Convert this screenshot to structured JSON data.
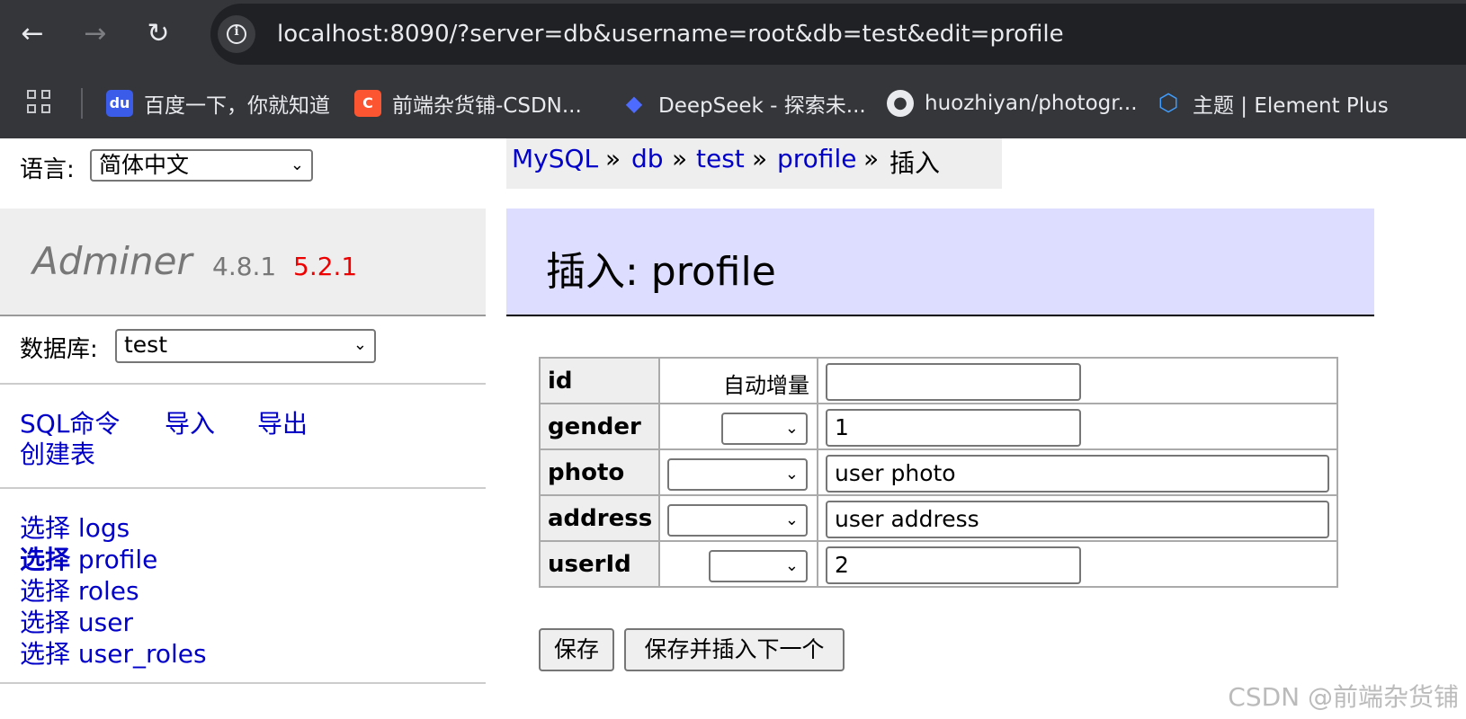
{
  "browser": {
    "back": "←",
    "forward": "→",
    "reload": "↻",
    "url": "localhost:8090/?server=db&username=root&db=test&edit=profile",
    "bookmarks": [
      {
        "label": "百度一下，你就知道",
        "icon": "baidu-icon"
      },
      {
        "label": "前端杂货铺-CSDN...",
        "icon": "csdn-icon"
      },
      {
        "label": "DeepSeek - 探索未...",
        "icon": "deepseek-icon"
      },
      {
        "label": "huozhiyan/photogr...",
        "icon": "github-icon"
      },
      {
        "label": "主题 | Element Plus",
        "icon": "element-plus-icon"
      }
    ]
  },
  "sidebar": {
    "lang_label": "语言:",
    "lang_value": "简体中文",
    "brand": "Adminer",
    "version": "4.8.1",
    "new_version": "5.2.1",
    "db_label": "数据库:",
    "db_value": "test",
    "links": [
      "SQL命令",
      "导入",
      "导出",
      "创建表"
    ],
    "tables": [
      {
        "action": "选择",
        "name": "logs"
      },
      {
        "action": "选择",
        "name": "profile"
      },
      {
        "action": "选择",
        "name": "roles"
      },
      {
        "action": "选择",
        "name": "user"
      },
      {
        "action": "选择",
        "name": "user_roles"
      }
    ]
  },
  "breadcrumb": {
    "items": [
      "MySQL",
      "db",
      "test",
      "profile"
    ],
    "sep": "»",
    "current": "插入"
  },
  "main": {
    "title": "插入: profile",
    "fields": [
      {
        "name": "id",
        "function": "自动增量",
        "value": ""
      },
      {
        "name": "gender",
        "function": "",
        "value": "1"
      },
      {
        "name": "photo",
        "function": "",
        "value": "user photo"
      },
      {
        "name": "address",
        "function": "",
        "value": "user address"
      },
      {
        "name": "userId",
        "function": "",
        "value": "2"
      }
    ],
    "save": "保存",
    "save_next": "保存并插入下一个"
  },
  "watermark": "CSDN @前端杂货铺",
  "colors": {
    "link": "#0000c8",
    "chrome": "#35363a",
    "heading_bg": "#ddddff",
    "new_version": "#ee0000"
  }
}
